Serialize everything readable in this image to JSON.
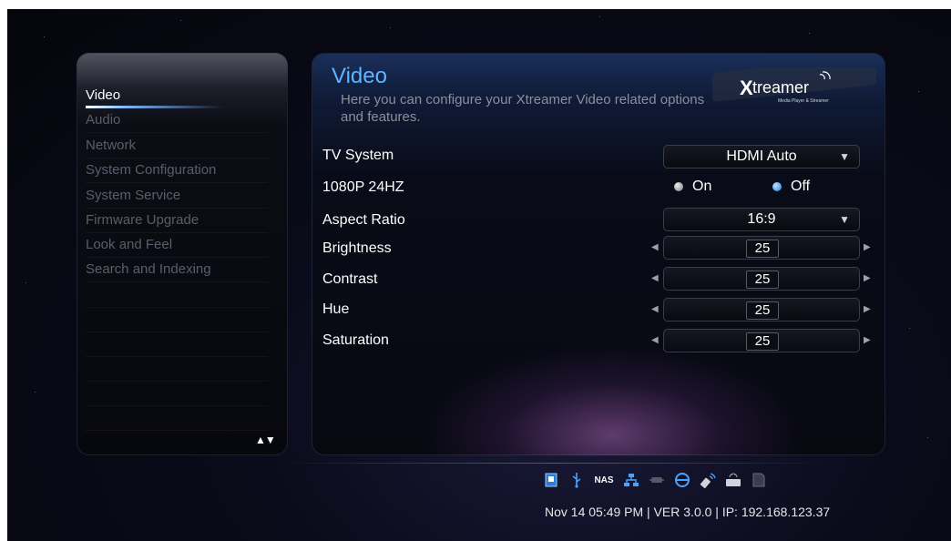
{
  "sidebar": {
    "items": [
      {
        "label": "Video",
        "active": true
      },
      {
        "label": "Audio",
        "active": false
      },
      {
        "label": "Network",
        "active": false
      },
      {
        "label": "System Configuration",
        "active": false
      },
      {
        "label": "System Service",
        "active": false
      },
      {
        "label": "Firmware Upgrade",
        "active": false
      },
      {
        "label": "Look and Feel",
        "active": false
      },
      {
        "label": "Search and Indexing",
        "active": false
      }
    ],
    "scroll_arrows": "▲▼"
  },
  "main": {
    "title": "Video",
    "subtitle": "Here you can configure your Xtreamer Video related options and features.",
    "logo_text": "Xtreamer",
    "logo_tagline": "Media Player & Streamer",
    "settings": {
      "tv_system": {
        "label": "TV System",
        "value": "HDMI Auto"
      },
      "p24hz": {
        "label": "1080P 24HZ",
        "on_label": "On",
        "off_label": "Off",
        "selected": "Off"
      },
      "aspect_ratio": {
        "label": "Aspect Ratio",
        "value": "16:9"
      },
      "brightness": {
        "label": "Brightness",
        "value": "25"
      },
      "contrast": {
        "label": "Contrast",
        "value": "25"
      },
      "hue": {
        "label": "Hue",
        "value": "25"
      },
      "saturation": {
        "label": "Saturation",
        "value": "25"
      }
    }
  },
  "status_bar": {
    "icons": [
      "storage-icon",
      "usb-icon",
      "nas-icon",
      "network-icon",
      "wireless-off-icon",
      "internet-icon",
      "wifi-dongle-icon",
      "keyboard-icon",
      "memory-card-icon"
    ],
    "nas_text": "NAS",
    "text": "Nov 14 05:49 PM | VER 3.0.0 | IP: 192.168.123.37"
  },
  "colors": {
    "accent": "#5fb3ff",
    "text": "#ffffff",
    "inactive": "#5a5e6a",
    "background": "#05060c"
  }
}
